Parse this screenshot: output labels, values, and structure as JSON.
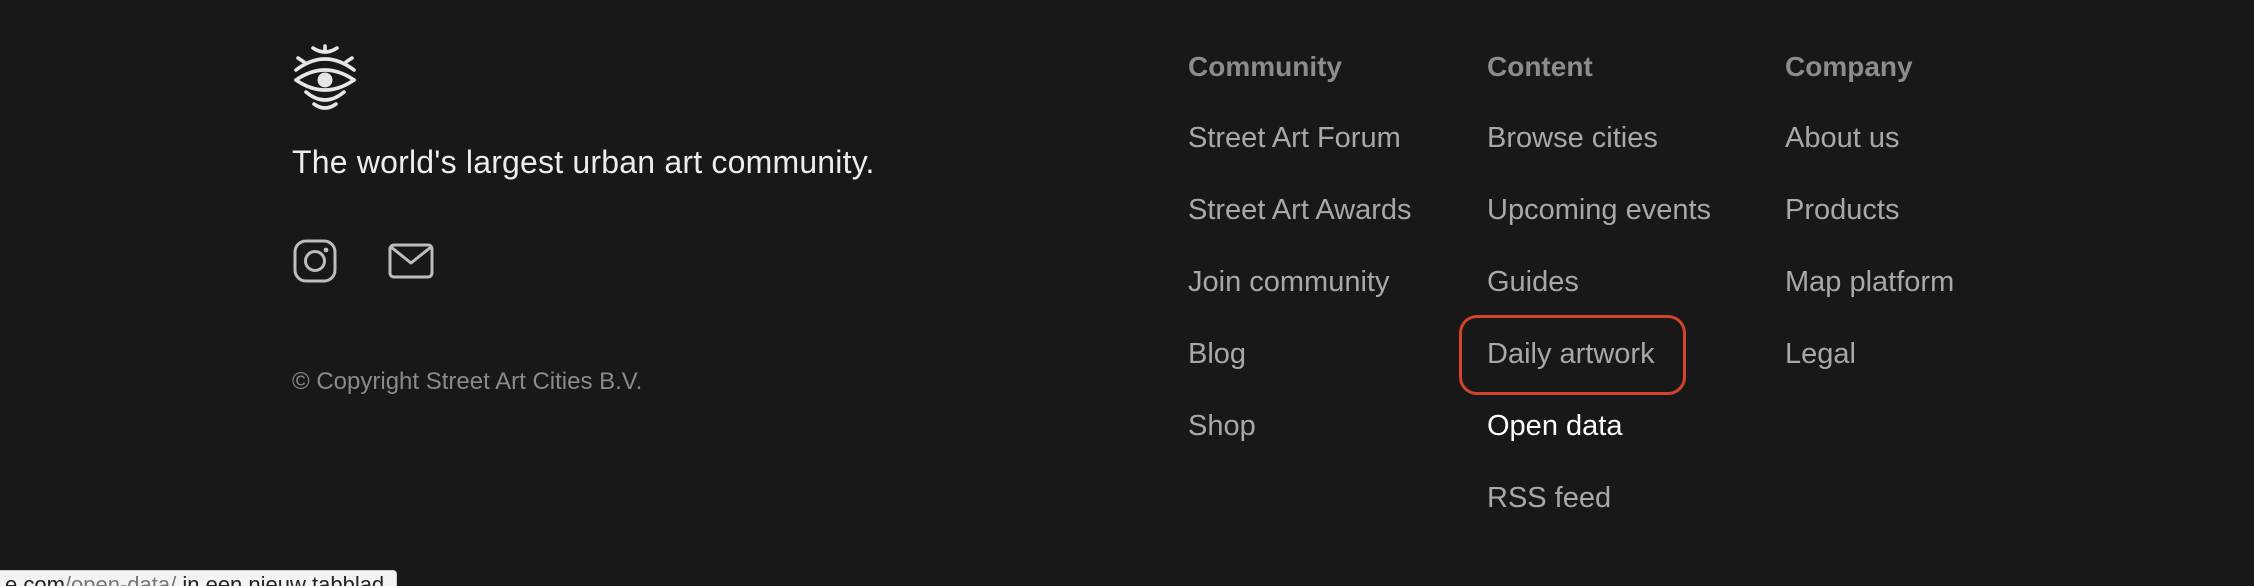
{
  "brand": {
    "logo_icon": "street-art-cities-logo-icon",
    "tagline": "The world's largest urban art community.",
    "copyright": "© Copyright Street Art Cities B.V."
  },
  "social": [
    {
      "name": "instagram",
      "icon": "instagram-icon"
    },
    {
      "name": "email",
      "icon": "mail-icon"
    }
  ],
  "columns": {
    "community": {
      "heading": "Community",
      "links": [
        "Street Art Forum",
        "Street Art Awards",
        "Join community",
        "Blog",
        "Shop"
      ]
    },
    "content": {
      "heading": "Content",
      "links": [
        "Browse cities",
        "Upcoming events",
        "Guides",
        "Daily artwork",
        "Open data",
        "RSS feed"
      ]
    },
    "company": {
      "heading": "Company",
      "links": [
        "About us",
        "Products",
        "Map platform",
        "Legal"
      ]
    }
  },
  "status_bar": {
    "host": "e.com",
    "path": "/open-data/",
    "suffix": " in een nieuw tabblad"
  },
  "colors": {
    "background": "#181818",
    "link": "#a8a8a8",
    "link_hover": "#ffffff",
    "heading": "#8c8c8c",
    "focus_ring": "#d2432b"
  }
}
